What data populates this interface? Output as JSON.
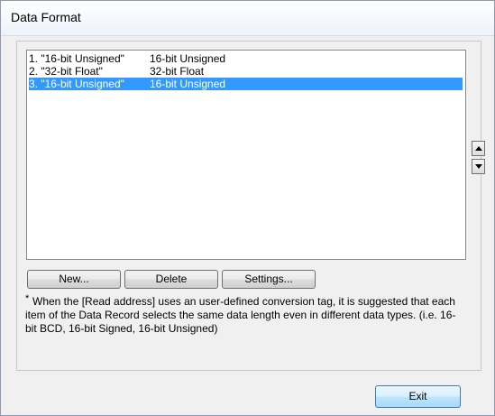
{
  "window": {
    "title": "Data Format"
  },
  "list": {
    "items": [
      {
        "name": "1. \"16-bit Unsigned\"",
        "type": "16-bit Unsigned",
        "selected": false
      },
      {
        "name": "2. \"32-bit Float\"",
        "type": "32-bit Float",
        "selected": false
      },
      {
        "name": "3. \"16-bit Unsigned\"",
        "type": "16-bit Unsigned",
        "selected": true
      }
    ]
  },
  "buttons": {
    "new": "New...",
    "delete": "Delete",
    "settings": "Settings...",
    "exit": "Exit"
  },
  "note": {
    "marker": "*",
    "text": "When the [Read address] uses an user-defined conversion tag, it is suggested that each item of the Data Record selects the same data length even in different data types. (i.e. 16-bit BCD, 16-bit Signed, 16-bit Unsigned)"
  },
  "icons": {
    "move_up": "arrow-up-icon",
    "move_down": "arrow-down-icon"
  },
  "colors": {
    "selection": "#3399ff",
    "dialog_bg": "#f0f0f0"
  }
}
